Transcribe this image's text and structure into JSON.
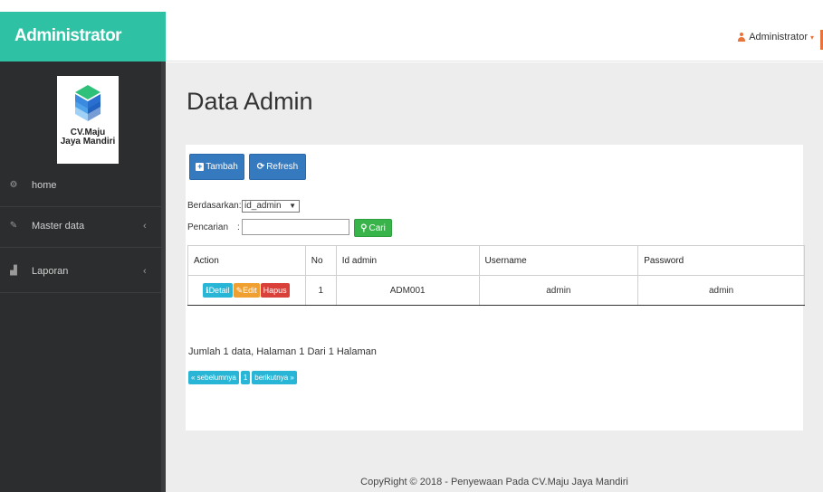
{
  "brand": {
    "title": "Administrator"
  },
  "topbar": {
    "user_label": "Administrator",
    "user_caret": "▾"
  },
  "logo": {
    "line1": "CV.Maju",
    "line2": "Jaya Mandiri"
  },
  "sidebar": {
    "items": [
      {
        "label": "home",
        "icon": "dashboard-icon",
        "glyph": "⚙",
        "has_caret": false
      },
      {
        "label": "Master data",
        "icon": "edit-icon",
        "glyph": "✎",
        "has_caret": true,
        "caret": "‹"
      },
      {
        "label": "Laporan",
        "icon": "chart-icon",
        "glyph": "▟",
        "has_caret": true,
        "caret": "‹"
      }
    ]
  },
  "page": {
    "title": "Data Admin"
  },
  "toolbar": {
    "add_label": "Tambah",
    "refresh_label": "Refresh"
  },
  "filter": {
    "by_label": "Berdasarkan:",
    "by_value": "id_admin",
    "by_arrow": "▼",
    "search_label": "Pencarian",
    "search_colon": ":",
    "search_button": "Cari"
  },
  "table": {
    "headers": [
      "Action",
      "No",
      "Id admin",
      "Username",
      "Password"
    ],
    "rows": [
      {
        "no": "1",
        "id_admin": "ADM001",
        "username": "admin",
        "password": "admin",
        "detail_label": "Detail",
        "edit_label": "Edit",
        "delete_label": "Hapus"
      }
    ]
  },
  "summary": "Jumlah 1 data, Halaman 1 Dari 1 Halaman",
  "pagination": {
    "prev": "« sebelumnya",
    "page": "1",
    "next": "berikutnya »"
  },
  "footer": "CopyRight © 2018 - Penyewaan Pada CV.Maju Jaya Mandiri",
  "colors": {
    "brand": "#2ec1a4",
    "sidebar": "#2b2d2f",
    "primary": "#3579bf",
    "success": "#38b44a",
    "info": "#29b6d6",
    "warning": "#f0a030",
    "danger": "#d9403a",
    "user_accent": "#e8743b"
  }
}
